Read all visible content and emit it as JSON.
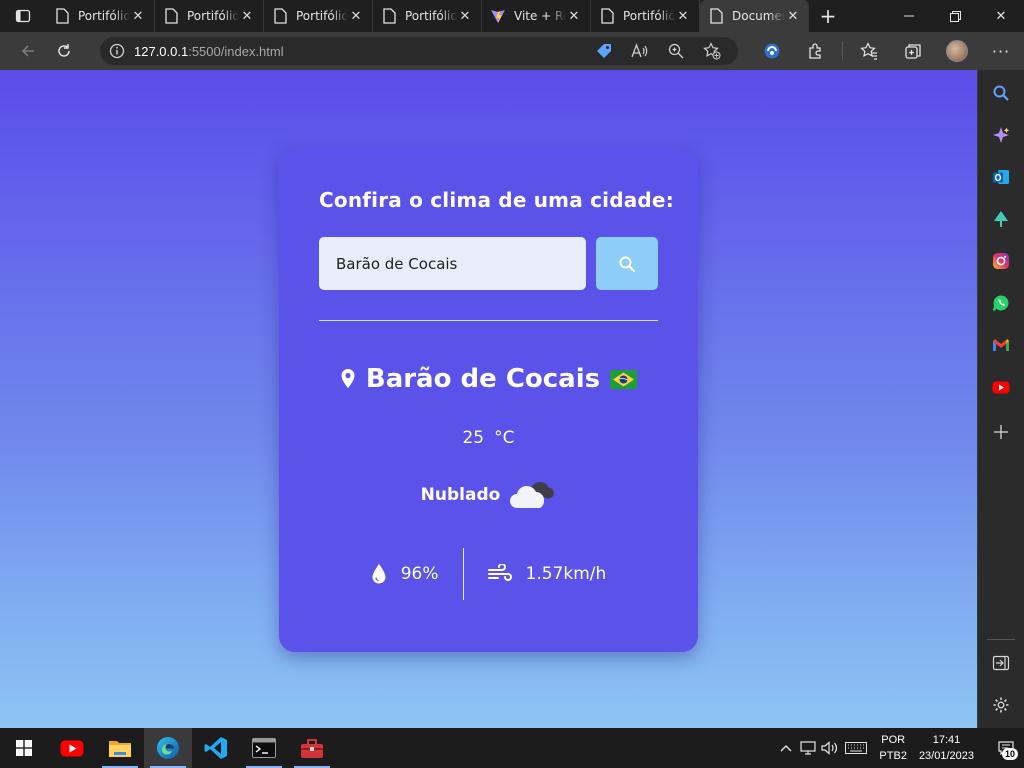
{
  "browser": {
    "tabs": [
      {
        "title": "Portifólio",
        "icon": "page-icon",
        "active": false
      },
      {
        "title": "Portifólio",
        "icon": "page-icon",
        "active": false
      },
      {
        "title": "Portifólio",
        "icon": "page-icon",
        "active": false
      },
      {
        "title": "Portifólio",
        "icon": "page-icon",
        "active": false
      },
      {
        "title": "Vite + React",
        "icon": "vite-icon",
        "active": false
      },
      {
        "title": "Portifólio",
        "icon": "page-icon",
        "active": false
      },
      {
        "title": "Document",
        "icon": "page-icon",
        "active": true
      }
    ],
    "url_host": "127.0.0.1",
    "url_path": ":5500/index.html"
  },
  "app": {
    "heading": "Confira o clima de uma cidade:",
    "search_value": "Barão de Cocais",
    "city": "Barão de Cocais",
    "country_flag": "BR",
    "temperature": "25",
    "temperature_unit": "°C",
    "condition": "Nublado",
    "condition_icon": "cloudy-icon",
    "humidity": "96%",
    "wind": "1.57km/h"
  },
  "taskbar": {
    "apps": [
      "youtube",
      "file-explorer",
      "edge",
      "vscode",
      "terminal",
      "toolbox"
    ],
    "language_line1": "POR",
    "language_line2": "PTB2",
    "time": "17:41",
    "date": "23/01/2023",
    "notification_count": "10"
  },
  "colors": {
    "card": "#5b52ea",
    "search_button": "#8dcdf6",
    "input_bg": "#e8edfb",
    "gradient_top": "#5b4deb",
    "gradient_bottom": "#8cc6f4"
  }
}
